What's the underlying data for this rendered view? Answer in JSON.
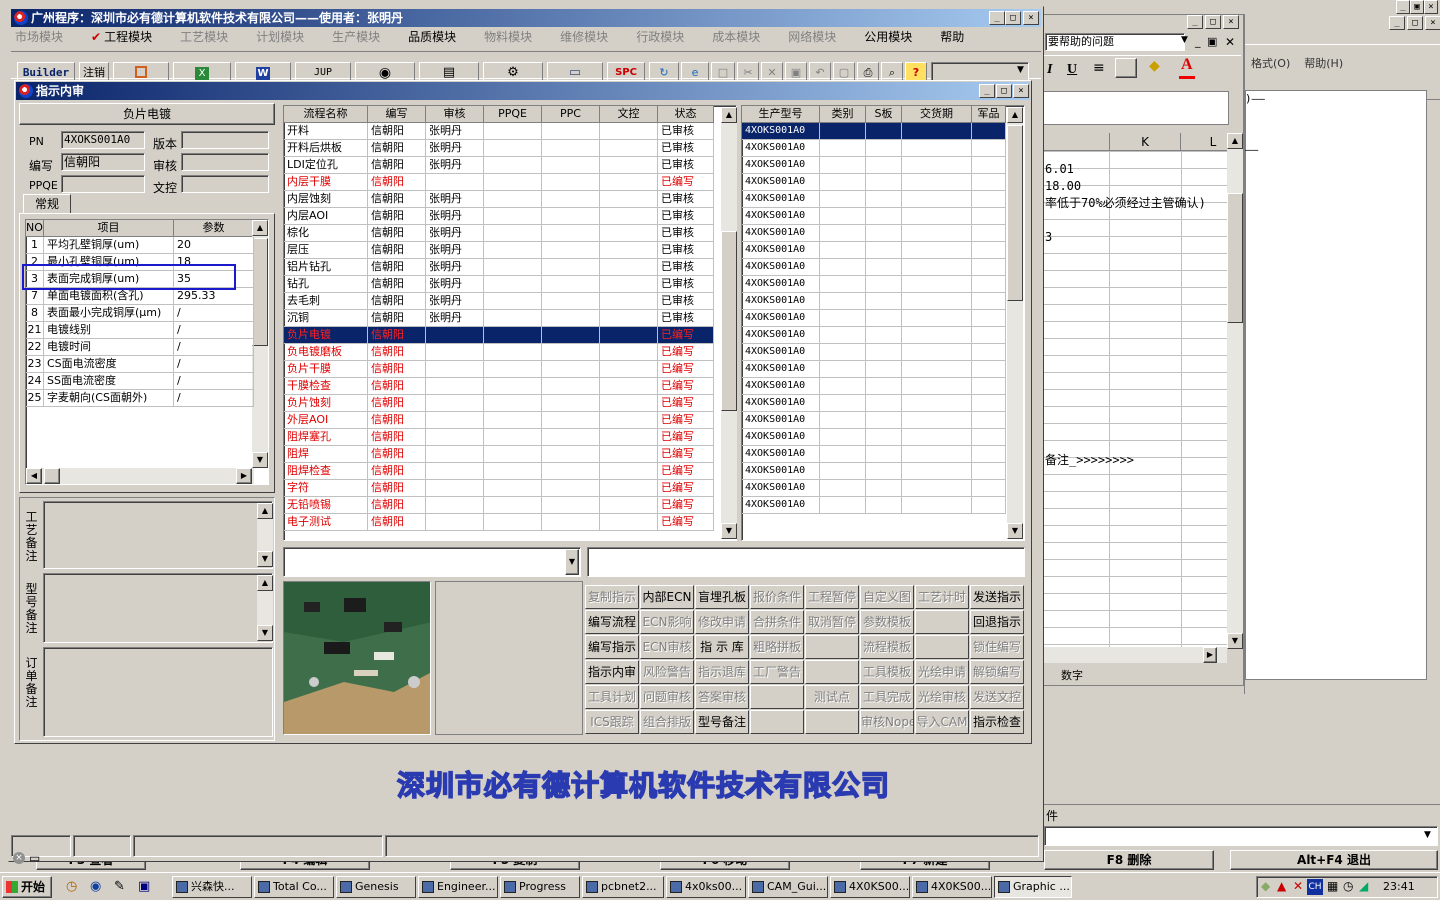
{
  "desktop": {
    "excel": {
      "help_box": "要帮助的问题",
      "menu": [
        "格式(O)",
        "帮助(H)"
      ],
      "col_k": "K",
      "col_l": "L",
      "cells": [
        "6.01",
        "18.00",
        "率低于70%必须经过主管确认)",
        "3",
        "备注_>>>>>>>>"
      ],
      "status": "数字",
      "note": "件"
    },
    "fkeys": [
      "F3 查看",
      "F4 编辑",
      "F5 复制",
      "F6 移动",
      "F7 新建",
      "F8 删除",
      "Alt+F4 退出"
    ]
  },
  "main": {
    "title": "广州程序：深圳市必有德计算机软件技术有限公司——使用者：张明丹",
    "menu": [
      {
        "label": "市场模块",
        "enabled": false
      },
      {
        "label": "工程模块",
        "enabled": true,
        "checked": true
      },
      {
        "label": "工艺模块",
        "enabled": false
      },
      {
        "label": "计划模块",
        "enabled": false
      },
      {
        "label": "生产模块",
        "enabled": false
      },
      {
        "label": "品质模块",
        "enabled": true
      },
      {
        "label": "物料模块",
        "enabled": false
      },
      {
        "label": "维修模块",
        "enabled": false
      },
      {
        "label": "行政模块",
        "enabled": false
      },
      {
        "label": "成本模块",
        "enabled": false
      },
      {
        "label": "网络模块",
        "enabled": false
      },
      {
        "label": "公用模块",
        "enabled": true
      },
      {
        "label": "帮助",
        "enabled": true
      }
    ],
    "toolbar": {
      "builder": "Builder",
      "cancel": "注销",
      "jup": "JUP",
      "spc": "SPC",
      "help": "?"
    },
    "footer_company": "深圳市必有德计算机软件技术有限公司"
  },
  "dialog": {
    "title": "指示内审",
    "process_name": "负片电镀",
    "labels": {
      "pn": "PN",
      "version": "版本",
      "author": "编写",
      "review": "审核",
      "ppqe": "PPQE",
      "doc": "文控"
    },
    "pn_value": "4XOKS001A0",
    "author_value": "信朝阳",
    "tab": "常规",
    "param_headers": [
      "NO",
      "项目",
      "参数"
    ],
    "params": [
      {
        "no": "1",
        "item": "平均孔壁铜厚(um)",
        "val": "20"
      },
      {
        "no": "2",
        "item": "最小孔壁铜厚(um)",
        "val": "18"
      },
      {
        "no": "3",
        "item": "表面完成铜厚(um)",
        "val": "35"
      },
      {
        "no": "7",
        "item": "单面电镀面积(含孔)",
        "val": "295.33"
      },
      {
        "no": "8",
        "item": "表面最小完成铜厚(μm)",
        "val": "/"
      },
      {
        "no": "21",
        "item": "电镀线别",
        "val": "/"
      },
      {
        "no": "22",
        "item": "电镀时间",
        "val": "/"
      },
      {
        "no": "23",
        "item": "CS面电流密度",
        "val": "/"
      },
      {
        "no": "24",
        "item": "SS面电流密度",
        "val": "/"
      },
      {
        "no": "25",
        "item": "字麦朝向(CS面朝外)",
        "val": "/"
      }
    ],
    "notes": [
      "工艺备注",
      "型号备注",
      "订单备注"
    ],
    "flow_headers": [
      "流程名称",
      "编写",
      "审核",
      "PPQE",
      "PPC",
      "文控",
      "状态"
    ],
    "flows": [
      {
        "name": "开料",
        "author": "信朝阳",
        "reviewer": "张明丹",
        "status": "已审核",
        "red": false
      },
      {
        "name": "开料后烘板",
        "author": "信朝阳",
        "reviewer": "张明丹",
        "status": "已审核",
        "red": false
      },
      {
        "name": "LDI定位孔",
        "author": "信朝阳",
        "reviewer": "张明丹",
        "status": "已审核",
        "red": false
      },
      {
        "name": "内层干膜",
        "author": "信朝阳",
        "reviewer": "",
        "status": "已编写",
        "red": true
      },
      {
        "name": "内层蚀刻",
        "author": "信朝阳",
        "reviewer": "张明丹",
        "status": "已审核",
        "red": false
      },
      {
        "name": "内层AOI",
        "author": "信朝阳",
        "reviewer": "张明丹",
        "status": "已审核",
        "red": false
      },
      {
        "name": "棕化",
        "author": "信朝阳",
        "reviewer": "张明丹",
        "status": "已审核",
        "red": false
      },
      {
        "name": "层压",
        "author": "信朝阳",
        "reviewer": "张明丹",
        "status": "已审核",
        "red": false
      },
      {
        "name": "铝片钻孔",
        "author": "信朝阳",
        "reviewer": "张明丹",
        "status": "已审核",
        "red": false
      },
      {
        "name": "钻孔",
        "author": "信朝阳",
        "reviewer": "张明丹",
        "status": "已审核",
        "red": false
      },
      {
        "name": "去毛刺",
        "author": "信朝阳",
        "reviewer": "张明丹",
        "status": "已审核",
        "red": false
      },
      {
        "name": "沉铜",
        "author": "信朝阳",
        "reviewer": "张明丹",
        "status": "已审核",
        "red": false
      },
      {
        "name": "负片电镀",
        "author": "信朝阳",
        "reviewer": "",
        "status": "已编写",
        "red": true,
        "selected": true
      },
      {
        "name": "负电镀磨板",
        "author": "信朝阳",
        "reviewer": "",
        "status": "已编写",
        "red": true
      },
      {
        "name": "负片干膜",
        "author": "信朝阳",
        "reviewer": "",
        "status": "已编写",
        "red": true
      },
      {
        "name": "干膜检查",
        "author": "信朝阳",
        "reviewer": "",
        "status": "已编写",
        "red": true
      },
      {
        "name": "负片蚀刻",
        "author": "信朝阳",
        "reviewer": "",
        "status": "已编写",
        "red": true
      },
      {
        "name": "外层AOI",
        "author": "信朝阳",
        "reviewer": "",
        "status": "已编写",
        "red": true
      },
      {
        "name": "阻焊塞孔",
        "author": "信朝阳",
        "reviewer": "",
        "status": "已编写",
        "red": true
      },
      {
        "name": "阻焊",
        "author": "信朝阳",
        "reviewer": "",
        "status": "已编写",
        "red": true
      },
      {
        "name": "阻焊检查",
        "author": "信朝阳",
        "reviewer": "",
        "status": "已编写",
        "red": true
      },
      {
        "name": "字符",
        "author": "信朝阳",
        "reviewer": "",
        "status": "已编写",
        "red": true
      },
      {
        "name": "无铅喷锡",
        "author": "信朝阳",
        "reviewer": "",
        "status": "已编写",
        "red": true
      },
      {
        "name": "电子测试",
        "author": "信朝阳",
        "reviewer": "",
        "status": "已编写",
        "red": true
      }
    ],
    "model_headers": [
      "生产型号",
      "类别",
      "S板",
      "交货期",
      "军品"
    ],
    "model_value": "4XOKS001A0",
    "model_rows": 23,
    "actions": [
      [
        {
          "l": "复制指示",
          "d": true
        },
        {
          "l": "内部ECN",
          "d": false
        },
        {
          "l": "盲埋孔板",
          "d": false
        },
        {
          "l": "报价条件",
          "d": true
        },
        {
          "l": "工程暂停",
          "d": true
        },
        {
          "l": "自定义图",
          "d": true
        },
        {
          "l": "工艺计时",
          "d": true
        },
        {
          "l": "发送指示",
          "d": false
        }
      ],
      [
        {
          "l": "编写流程",
          "d": false
        },
        {
          "l": "ECN影响",
          "d": true
        },
        {
          "l": "修改申请",
          "d": true
        },
        {
          "l": "合拼条件",
          "d": true
        },
        {
          "l": "取消暂停",
          "d": true
        },
        {
          "l": "参数模板",
          "d": true
        },
        {
          "l": "",
          "d": true
        },
        {
          "l": "回退指示",
          "d": false
        }
      ],
      [
        {
          "l": "编写指示",
          "d": false
        },
        {
          "l": "ECN审核",
          "d": true
        },
        {
          "l": "指 示 库",
          "d": false
        },
        {
          "l": "粗略拼板",
          "d": true
        },
        {
          "l": "",
          "d": true
        },
        {
          "l": "流程模板",
          "d": true
        },
        {
          "l": "",
          "d": true
        },
        {
          "l": "锁住编写",
          "d": true
        }
      ],
      [
        {
          "l": "指示内审",
          "d": false
        },
        {
          "l": "风险警告",
          "d": true
        },
        {
          "l": "指示退库",
          "d": true
        },
        {
          "l": "工厂警告",
          "d": true
        },
        {
          "l": "",
          "d": true
        },
        {
          "l": "工具模板",
          "d": true
        },
        {
          "l": "光绘申请",
          "d": true
        },
        {
          "l": "解锁编写",
          "d": true
        }
      ],
      [
        {
          "l": "工具计划",
          "d": true
        },
        {
          "l": "问题审核",
          "d": true
        },
        {
          "l": "答案审核",
          "d": true
        },
        {
          "l": "",
          "d": true
        },
        {
          "l": "测试点",
          "d": true
        },
        {
          "l": "工具完成",
          "d": true
        },
        {
          "l": "光绘审核",
          "d": true
        },
        {
          "l": "发送文控",
          "d": true
        }
      ],
      [
        {
          "l": "ICS跟踪",
          "d": true
        },
        {
          "l": "组合排版",
          "d": true
        },
        {
          "l": "型号备注",
          "d": false
        },
        {
          "l": "",
          "d": true
        },
        {
          "l": "",
          "d": true
        },
        {
          "l": "审核Nope",
          "d": true
        },
        {
          "l": "导入CAM",
          "d": true
        },
        {
          "l": "指示检查",
          "d": false
        }
      ]
    ]
  },
  "taskbar": {
    "start": "开始",
    "items": [
      "兴森快...",
      "Total Co...",
      "Genesis",
      "Engineer...",
      "Progress",
      "pcbnet2...",
      "4x0ks00...",
      "CAM_Gui...",
      "4X0KS00...",
      "4X0KS00...",
      "Graphic ..."
    ],
    "active_index": 10,
    "clock": "23:41",
    "tray_ch": "CH"
  }
}
